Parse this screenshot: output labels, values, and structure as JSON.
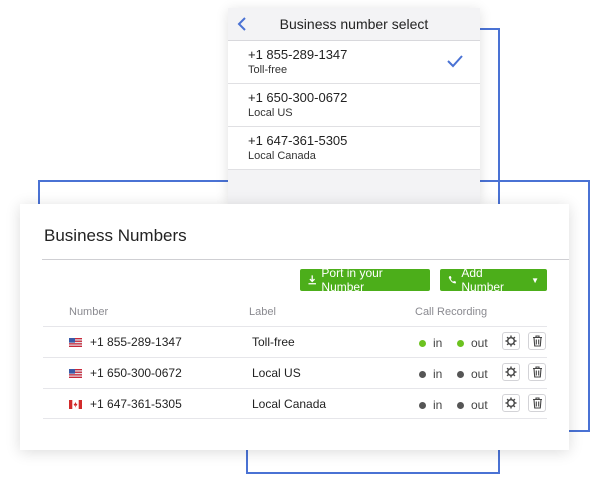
{
  "selector": {
    "title": "Business number select",
    "options": [
      {
        "number": "+1 855-289-1347",
        "type": "Toll-free",
        "selected": true
      },
      {
        "number": "+1 650-300-0672",
        "type": "Local US",
        "selected": false
      },
      {
        "number": "+1 647-361-5305",
        "type": "Local Canada",
        "selected": false
      }
    ]
  },
  "business_numbers": {
    "title": "Business Numbers",
    "port_button": "Port in your Number",
    "add_button": "Add Number",
    "columns": {
      "number": "Number",
      "label": "Label",
      "recording": "Call Recording"
    },
    "rows": [
      {
        "flag": "us-flag-icon",
        "number": "+1 855-289-1347",
        "label": "Toll-free",
        "in": "in",
        "out": "out",
        "in_color": "#6cc21f",
        "out_color": "#6cc21f"
      },
      {
        "flag": "us-flag-icon",
        "number": "+1 650-300-0672",
        "label": "Local US",
        "in": "in",
        "out": "out",
        "in_color": "#555555",
        "out_color": "#555555"
      },
      {
        "flag": "canada-flag-icon",
        "number": "+1 647-361-5305",
        "label": "Local Canada",
        "in": "in",
        "out": "out",
        "in_color": "#555555",
        "out_color": "#555555"
      }
    ]
  },
  "colors": {
    "accent_blue": "#4a72d4",
    "button_green": "#4cae1a"
  }
}
